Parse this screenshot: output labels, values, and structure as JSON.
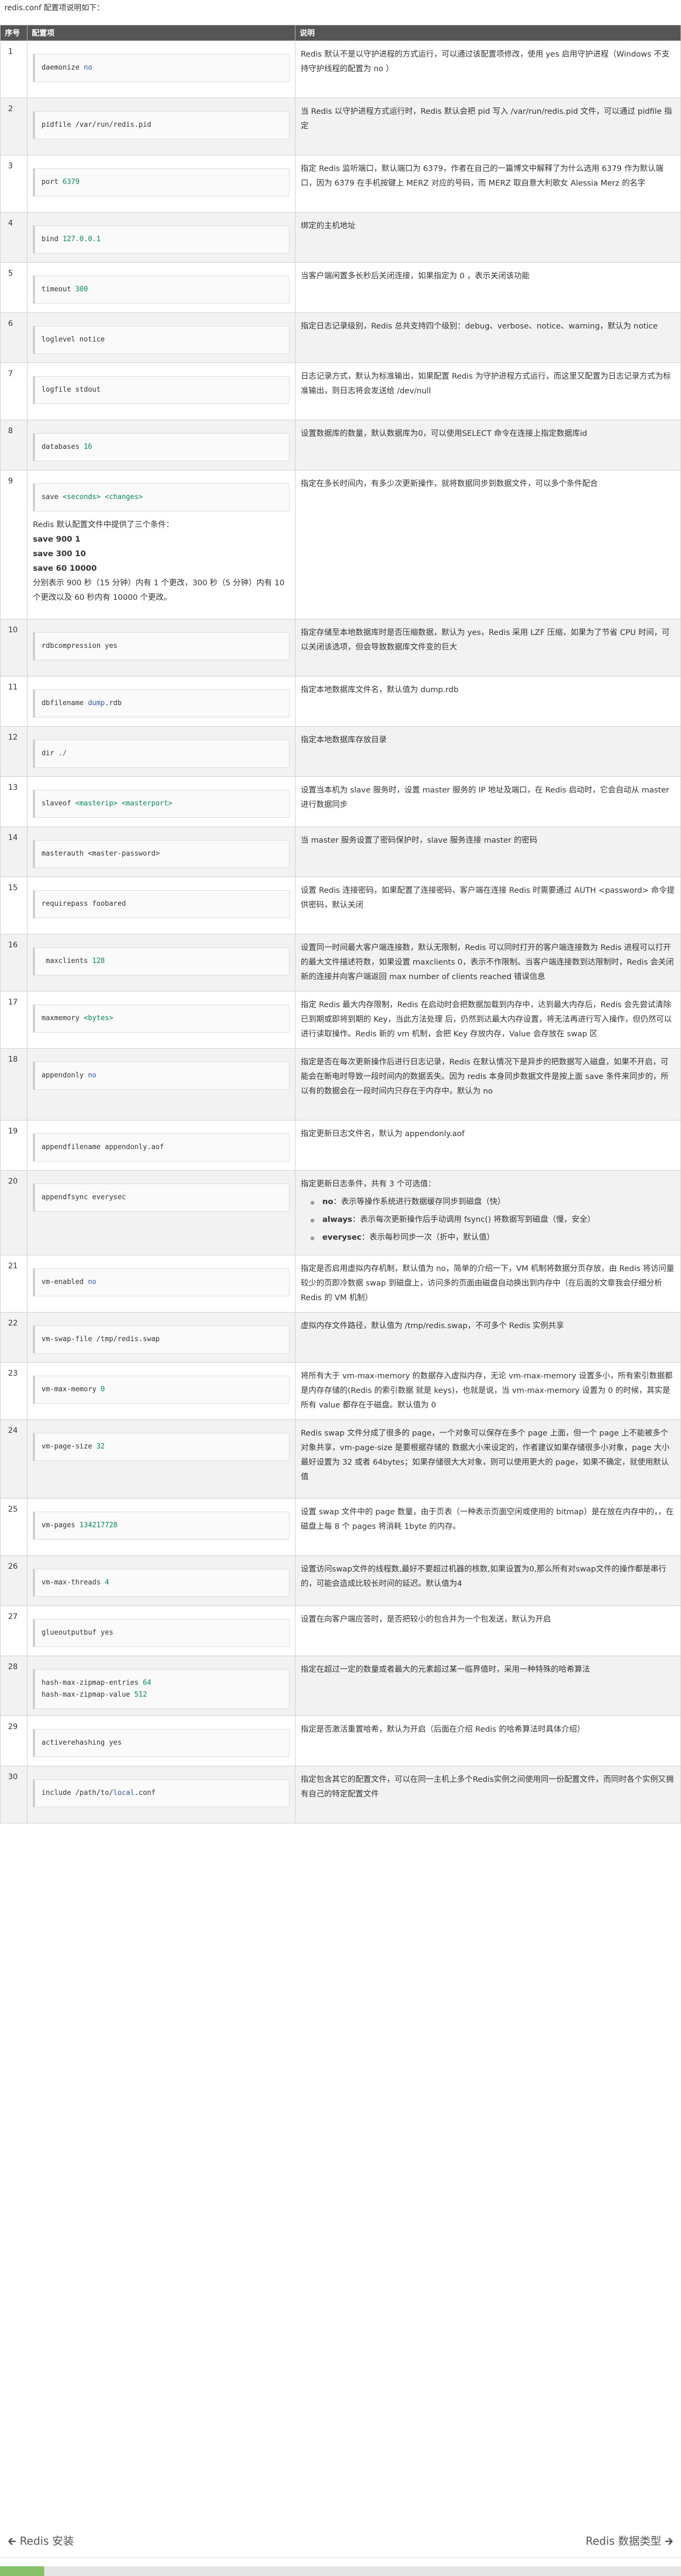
{
  "intro": "redis.conf 配置项说明如下：",
  "headers": [
    "序号",
    "配置项",
    "说明"
  ],
  "rows": [
    {
      "index": "1",
      "code": [
        [
          [
            "daemonize ",
            ""
          ],
          [
            "no",
            "kw"
          ]
        ]
      ],
      "desc": "Redis 默认不是以守护进程的方式运行，可以通过该配置项修改，使用 yes 启用守护进程（Windows 不支持守护线程的配置为 no ）"
    },
    {
      "index": "2",
      "code": [
        [
          [
            "pidfile ",
            ""
          ],
          [
            "/var/run/redis.pid",
            ""
          ]
        ]
      ],
      "desc": "当 Redis 以守护进程方式运行时，Redis 默认会把 pid 写入 /var/run/redis.pid 文件，可以通过 pidfile 指定"
    },
    {
      "index": "3",
      "code": [
        [
          [
            "port ",
            ""
          ],
          [
            "6379",
            "num"
          ]
        ]
      ],
      "desc": "指定 Redis 监听端口，默认端口为 6379，作者在自己的一篇博文中解释了为什么选用 6379 作为默认端口，因为 6379 在手机按键上 MERZ 对应的号码，而 MERZ 取自意大利歌女 Alessia Merz 的名字"
    },
    {
      "index": "4",
      "code": [
        [
          [
            "bind ",
            ""
          ],
          [
            "127.0.0.1",
            "num"
          ]
        ]
      ],
      "desc": "绑定的主机地址"
    },
    {
      "index": "5",
      "code": [
        [
          [
            "timeout ",
            ""
          ],
          [
            "300",
            "num"
          ]
        ]
      ],
      "desc": "当客户端闲置多长秒后关闭连接，如果指定为 0 ，表示关闭该功能"
    },
    {
      "index": "6",
      "code": [
        [
          [
            "loglevel notice",
            ""
          ]
        ]
      ],
      "desc": "指定日志记录级别，Redis 总共支持四个级别：debug、verbose、notice、warning，默认为 notice"
    },
    {
      "index": "7",
      "code": [
        [
          [
            "logfile stdout",
            ""
          ]
        ]
      ],
      "desc": "日志记录方式，默认为标准输出，如果配置 Redis 为守护进程方式运行，而这里又配置为日志记录方式为标准输出，则日志将会发送给 /dev/null"
    },
    {
      "index": "8",
      "code": [
        [
          [
            "databases ",
            ""
          ],
          [
            "16",
            "num"
          ]
        ]
      ],
      "desc": "设置数据库的数量，默认数据库为0，可以使用SELECT 命令在连接上指定数据库id"
    },
    {
      "index": "9",
      "code": [
        [
          [
            "save ",
            ""
          ],
          [
            "<seconds>",
            "str"
          ],
          [
            " ",
            ""
          ],
          [
            "<changes>",
            "str"
          ]
        ]
      ],
      "note": {
        "lead": "Redis 默认配置文件中提供了三个条件：",
        "bold": [
          "save 900 1",
          "save 300 10",
          "save 60 10000"
        ],
        "tail": "分别表示 900 秒（15 分钟）内有 1 个更改，300 秒（5 分钟）内有 10 个更改以及 60 秒内有 10000 个更改。"
      },
      "desc": "指定在多长时间内，有多少次更新操作，就将数据同步到数据文件，可以多个条件配合"
    },
    {
      "index": "10",
      "code": [
        [
          [
            "rdbcompression yes",
            ""
          ]
        ]
      ],
      "desc": "指定存储至本地数据库时是否压缩数据，默认为 yes，Redis 采用 LZF 压缩，如果为了节省 CPU 时间，可以关闭该选项，但会导致数据库文件变的巨大"
    },
    {
      "index": "11",
      "code": [
        [
          [
            "dbfilename ",
            ""
          ],
          [
            "dump",
            "kw"
          ],
          [
            ".rdb",
            ""
          ]
        ]
      ],
      "desc": "指定本地数据库文件名，默认值为 dump.rdb"
    },
    {
      "index": "12",
      "code": [
        [
          [
            "dir ",
            ""
          ],
          [
            "./",
            "kw"
          ]
        ]
      ],
      "desc": "指定本地数据库存放目录"
    },
    {
      "index": "13",
      "code": [
        [
          [
            "slaveof ",
            ""
          ],
          [
            "<masterip>",
            "str"
          ],
          [
            " ",
            ""
          ],
          [
            "<masterport>",
            "str"
          ]
        ]
      ],
      "desc": "设置当本机为 slave 服务时，设置 master 服务的 IP 地址及端口，在 Redis 启动时，它会自动从 master 进行数据同步"
    },
    {
      "index": "14",
      "code": [
        [
          [
            "masterauth <master-password>",
            ""
          ]
        ]
      ],
      "desc": "当 master 服务设置了密码保护时，slave 服务连接 master 的密码"
    },
    {
      "index": "15",
      "code": [
        [
          [
            "requirepass foobared",
            ""
          ]
        ]
      ],
      "desc": "设置 Redis 连接密码，如果配置了连接密码，客户端在连接 Redis 时需要通过 AUTH <password> 命令提供密码，默认关闭"
    },
    {
      "index": "16",
      "code": [
        [
          [
            " maxclients ",
            ""
          ],
          [
            "128",
            "num"
          ]
        ]
      ],
      "desc": "设置同一时间最大客户端连接数，默认无限制，Redis 可以同时打开的客户端连接数为 Redis 进程可以打开的最大文件描述符数，如果设置 maxclients 0，表示不作限制。当客户端连接数到达限制时，Redis 会关闭新的连接并向客户端返回 max number of clients reached 错误信息"
    },
    {
      "index": "17",
      "code": [
        [
          [
            "maxmemory ",
            ""
          ],
          [
            "<bytes>",
            "str"
          ]
        ]
      ],
      "desc": "指定 Redis 最大内存限制，Redis 在启动时会把数据加载到内存中，达到最大内存后，Redis 会先尝试清除已到期或即将到期的 Key，当此方法处理 后，仍然到达最大内存设置，将无法再进行写入操作，但仍然可以进行读取操作。Redis 新的 vm 机制，会把 Key 存放内存，Value 会存放在 swap 区"
    },
    {
      "index": "18",
      "code": [
        [
          [
            "appendonly ",
            ""
          ],
          [
            "no",
            "kw"
          ]
        ]
      ],
      "desc": "指定是否在每次更新操作后进行日志记录，Redis 在默认情况下是异步的把数据写入磁盘，如果不开启，可能会在断电时导致一段时间内的数据丢失。因为 redis 本身同步数据文件是按上面 save 条件来同步的，所以有的数据会在一段时间内只存在于内存中。默认为 no"
    },
    {
      "index": "19",
      "code": [
        [
          [
            "appendfilename appendonly.aof",
            ""
          ]
        ]
      ],
      "desc": "指定更新日志文件名，默认为 appendonly.aof"
    },
    {
      "index": "20",
      "code": [
        [
          [
            "appendfsync everysec",
            ""
          ]
        ]
      ],
      "desc": "指定更新日志条件，共有 3 个可选值：",
      "options": [
        [
          "no",
          "：表示等操作系统进行数据缓存同步到磁盘（快）"
        ],
        [
          "always",
          "：表示每次更新操作后手动调用 fsync() 将数据写到磁盘（慢，安全）"
        ],
        [
          "everysec",
          "：表示每秒同步一次（折中，默认值）"
        ]
      ]
    },
    {
      "index": "21",
      "code": [
        [
          [
            "vm-enabled ",
            ""
          ],
          [
            "no",
            "kw"
          ]
        ]
      ],
      "desc": "指定是否启用虚拟内存机制，默认值为 no，简单的介绍一下，VM 机制将数据分页存放，由 Redis 将访问量较少的页即冷数据 swap 到磁盘上，访问多的页面由磁盘自动换出到内存中（在后面的文章我会仔细分析 Redis 的 VM 机制）"
    },
    {
      "index": "22",
      "code": [
        [
          [
            "vm-swap-file /tmp/redis.swap",
            ""
          ]
        ]
      ],
      "desc": "虚拟内存文件路径，默认值为 /tmp/redis.swap，不可多个 Redis 实例共享"
    },
    {
      "index": "23",
      "code": [
        [
          [
            "vm-max-memory ",
            ""
          ],
          [
            "0",
            "num"
          ]
        ]
      ],
      "desc": "将所有大于 vm-max-memory 的数据存入虚拟内存，无论 vm-max-memory 设置多小，所有索引数据都是内存存储的(Redis 的索引数据 就是 keys)，也就是说，当 vm-max-memory 设置为 0 的时候，其实是所有 value 都存在于磁盘。默认值为 0"
    },
    {
      "index": "24",
      "code": [
        [
          [
            "vm-page-size ",
            ""
          ],
          [
            "32",
            "num"
          ]
        ]
      ],
      "desc": "Redis swap 文件分成了很多的 page，一个对象可以保存在多个 page 上面，但一个 page 上不能被多个对象共享，vm-page-size 是要根据存储的 数据大小来设定的，作者建议如果存储很多小对象，page 大小最好设置为 32 或者 64bytes；如果存储很大大对象，则可以使用更大的 page，如果不确定，就使用默认值"
    },
    {
      "index": "25",
      "code": [
        [
          [
            "vm-pages ",
            ""
          ],
          [
            "134217728",
            "num"
          ]
        ]
      ],
      "desc": "设置 swap 文件中的 page 数量，由于页表（一种表示页面空闲或使用的 bitmap）是在放在内存中的，，在磁盘上每 8 个 pages 将消耗 1byte 的内存。"
    },
    {
      "index": "26",
      "code": [
        [
          [
            "vm-max-threads ",
            ""
          ],
          [
            "4",
            "num"
          ]
        ]
      ],
      "desc": "设置访问swap文件的线程数,最好不要超过机器的核数,如果设置为0,那么所有对swap文件的操作都是串行的，可能会造成比较长时间的延迟。默认值为4"
    },
    {
      "index": "27",
      "code": [
        [
          [
            "glueoutputbuf yes",
            ""
          ]
        ]
      ],
      "desc": "设置在向客户端应答时，是否把较小的包合并为一个包发送，默认为开启"
    },
    {
      "index": "28",
      "code": [
        [
          [
            "hash-max-zipmap-entries ",
            ""
          ],
          [
            "64",
            "num"
          ]
        ],
        [
          [
            "hash-max-zipmap-value ",
            ""
          ],
          [
            "512",
            "num"
          ]
        ]
      ],
      "desc": "指定在超过一定的数量或者最大的元素超过某一临界值时，采用一种特殊的哈希算法"
    },
    {
      "index": "29",
      "code": [
        [
          [
            "activerehashing yes",
            ""
          ]
        ]
      ],
      "desc": "指定是否激活重置哈希，默认为开启（后面在介绍 Redis 的哈希算法时具体介绍）"
    },
    {
      "index": "30",
      "code": [
        [
          [
            "include /path/to/",
            ""
          ],
          [
            "local",
            "kw"
          ],
          [
            ".conf",
            ""
          ]
        ]
      ],
      "desc": "指定包含其它的配置文件，可以在同一主机上多个Redis实例之间使用同一份配置文件，而同时各个实例又拥有自己的特定配置文件"
    }
  ],
  "nav": {
    "prev": "Redis 安装",
    "next": "Redis 数据类型"
  },
  "colors": {
    "header_bg": "#555555",
    "stripe": "#f2f2f2",
    "footer_green": "#86c06b"
  }
}
